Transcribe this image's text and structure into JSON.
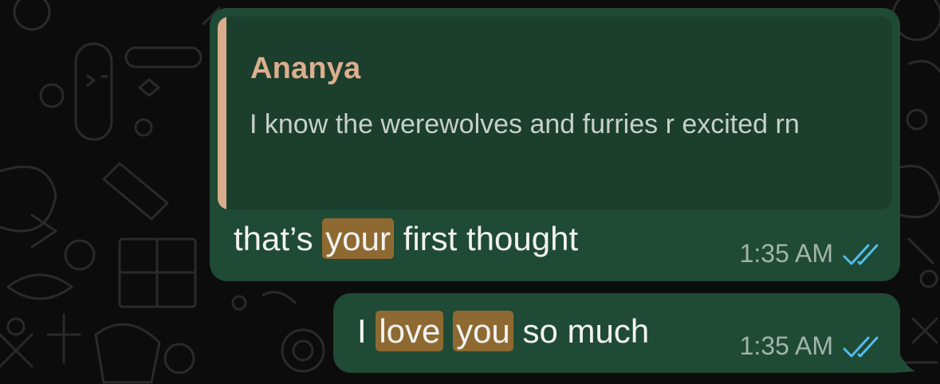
{
  "wallpaper": {
    "background": "#0c0c0c",
    "doodle_color": "#2a2a2a"
  },
  "colors": {
    "bubble": "#1f4a35",
    "quote_bg": "#1b3e2d",
    "quote_accent": "#d8ad8c",
    "highlight": "#8e6a32",
    "read_ticks": "#53bdeb"
  },
  "messages": [
    {
      "reply": {
        "author": "Ananya",
        "text": "I know the werewolves and furries r excited rn"
      },
      "parts": [
        {
          "text": "that’s ",
          "highlighted": false
        },
        {
          "text": "your",
          "highlighted": true
        },
        {
          "text": " first thought",
          "highlighted": false
        }
      ],
      "time": "1:35 AM",
      "status_icon": "double-check-read-icon"
    },
    {
      "parts": [
        {
          "text": "I ",
          "highlighted": false
        },
        {
          "text": "love",
          "highlighted": true
        },
        {
          "text": " ",
          "highlighted": false
        },
        {
          "text": "you",
          "highlighted": true
        },
        {
          "text": " so much",
          "highlighted": false
        }
      ],
      "time": "1:35 AM",
      "status_icon": "double-check-read-icon"
    }
  ]
}
